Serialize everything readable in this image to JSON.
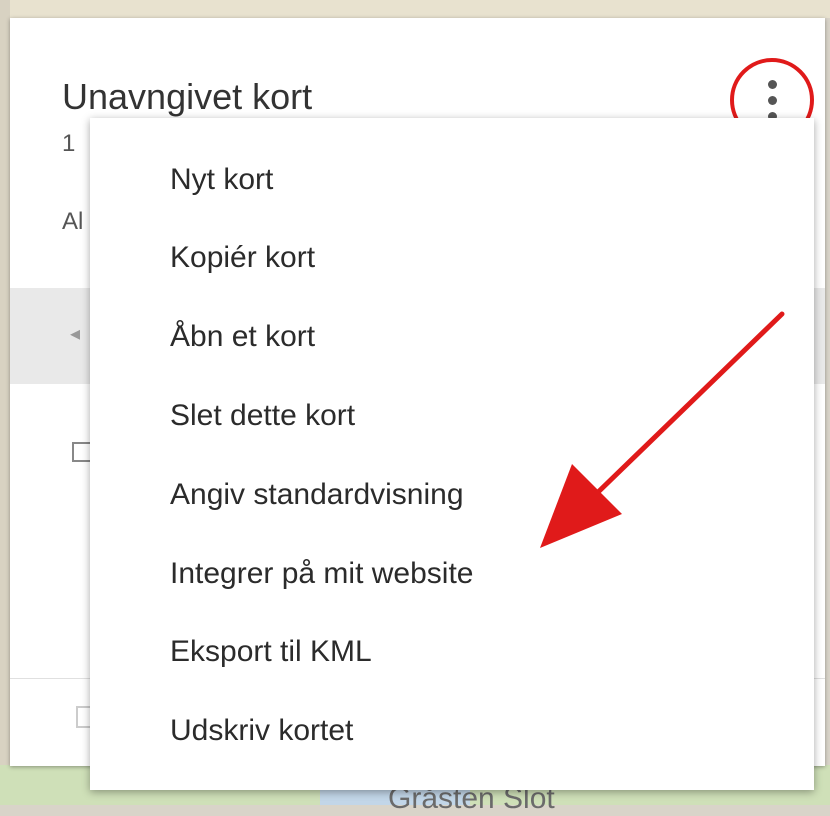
{
  "panel": {
    "title": "Unavngivet kort",
    "sub1": "1",
    "sub2": "Al"
  },
  "menu": {
    "items": [
      "Nyt kort",
      "Kopiér kort",
      "Åbn et kort",
      "Slet dette kort",
      "Angiv standardvisning",
      "Integrer på mit website",
      "Eksport til KML",
      "Udskriv kortet"
    ]
  },
  "map": {
    "label": "Gråsten Slot"
  },
  "icons": {
    "more": "more-vert-icon",
    "annotation_circle": "red-circle-annotation",
    "annotation_arrow": "red-arrow-annotation"
  },
  "colors": {
    "annotation": "#e01a1a",
    "menu_text": "#2b2b2b"
  }
}
